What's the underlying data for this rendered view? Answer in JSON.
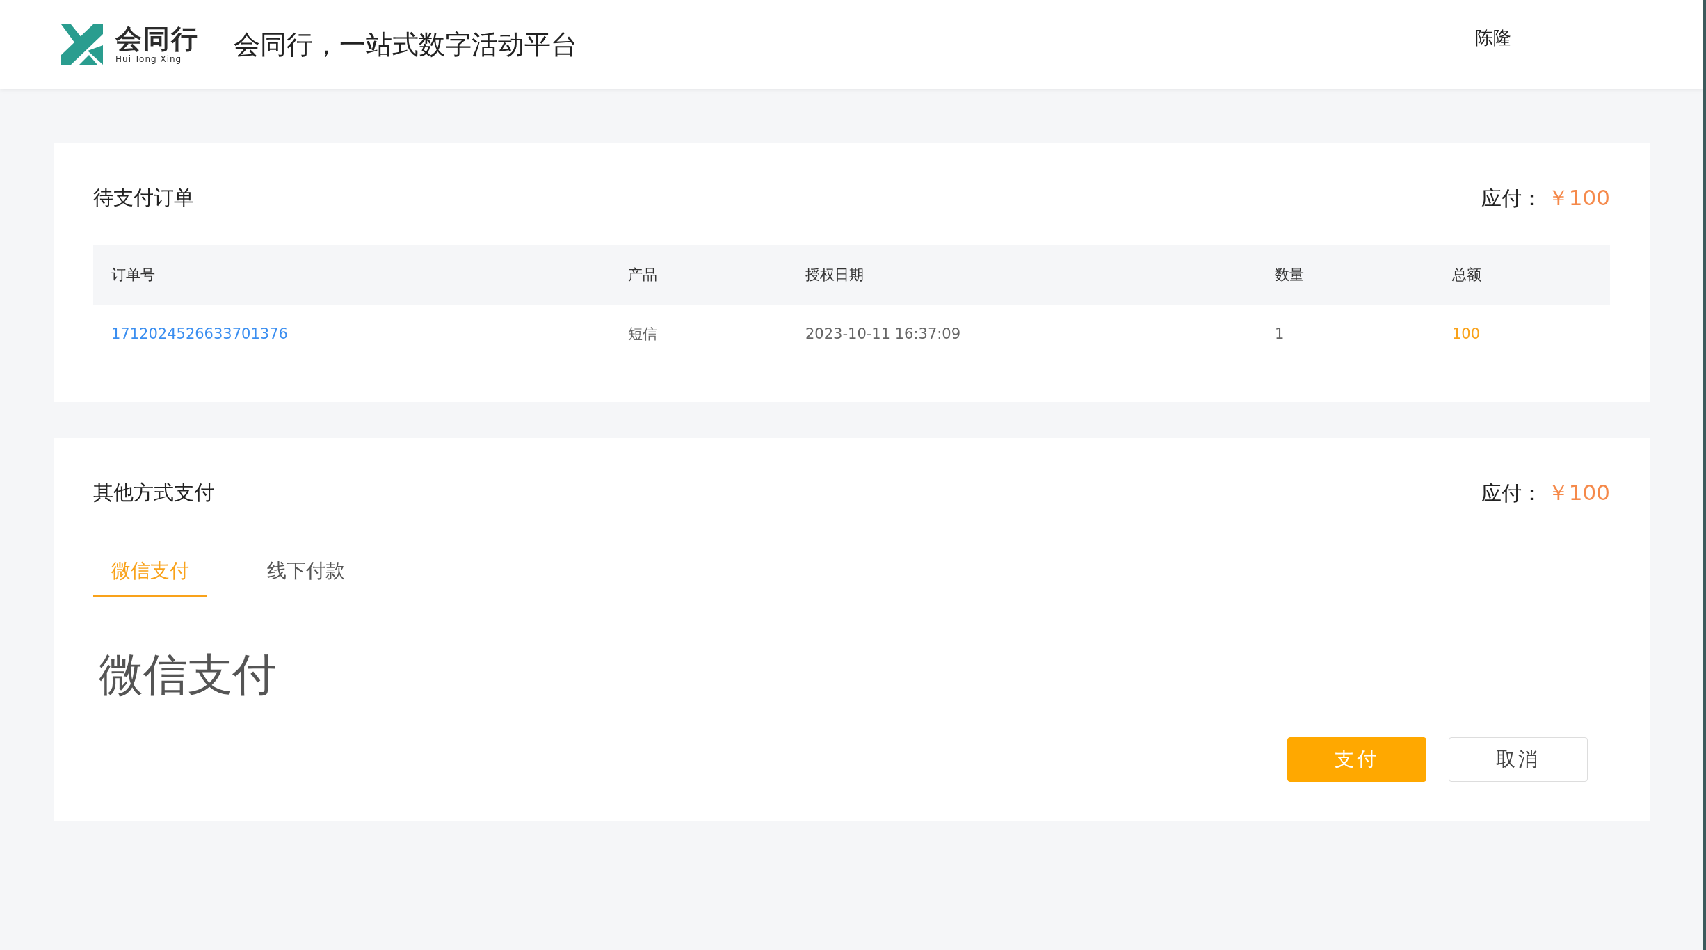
{
  "header": {
    "logo": {
      "name": "会同行",
      "subtitle": "Hui Tong Xing"
    },
    "title": "会同行，一站式数字活动平台",
    "user": "陈隆"
  },
  "order_card": {
    "title": "待支付订单",
    "due_label": "应付：",
    "due_amount": "￥100",
    "table": {
      "columns": [
        "订单号",
        "产品",
        "授权日期",
        "数量",
        "总额"
      ],
      "rows": [
        {
          "order_no": "1712024526633701376",
          "product": "短信",
          "date": "2023-10-11 16:37:09",
          "quantity": "1",
          "total": "100"
        }
      ]
    }
  },
  "payment_card": {
    "title": "其他方式支付",
    "due_label": "应付：",
    "due_amount": "￥100",
    "tabs": [
      {
        "label": "微信支付",
        "selected": true
      },
      {
        "label": "线下付款",
        "selected": false
      }
    ],
    "panel_text": "微信支付",
    "buttons": [
      {
        "label": "支付",
        "kind": "primary"
      },
      {
        "label": "取消",
        "kind": "secondary"
      }
    ]
  }
}
